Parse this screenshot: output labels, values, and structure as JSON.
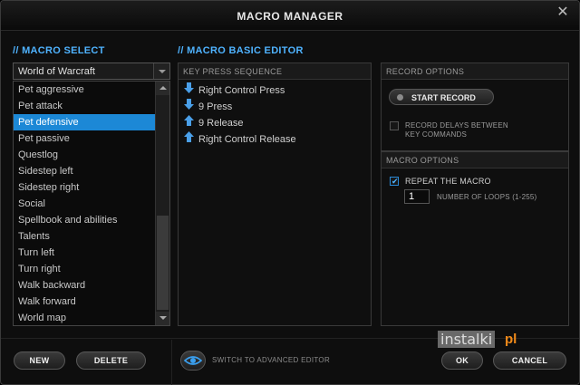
{
  "window": {
    "title": "MACRO MANAGER",
    "close_glyph": "✕"
  },
  "macro_select": {
    "section_title": "// MACRO SELECT",
    "game": "World of Warcraft",
    "items": [
      {
        "label": "Pet aggressive",
        "selected": false
      },
      {
        "label": "Pet attack",
        "selected": false
      },
      {
        "label": "Pet defensive",
        "selected": true
      },
      {
        "label": "Pet passive",
        "selected": false
      },
      {
        "label": "Questlog",
        "selected": false
      },
      {
        "label": "Sidestep left",
        "selected": false
      },
      {
        "label": "Sidestep right",
        "selected": false
      },
      {
        "label": "Social",
        "selected": false
      },
      {
        "label": "Spellbook and abilities",
        "selected": false
      },
      {
        "label": "Talents",
        "selected": false
      },
      {
        "label": "Turn left",
        "selected": false
      },
      {
        "label": "Turn right",
        "selected": false
      },
      {
        "label": "Walk backward",
        "selected": false
      },
      {
        "label": "Walk forward",
        "selected": false
      },
      {
        "label": "World map",
        "selected": false
      }
    ]
  },
  "editor": {
    "section_title": "// MACRO BASIC EDITOR",
    "sequence_header": "KEY PRESS SEQUENCE",
    "sequence": [
      {
        "direction": "down",
        "label": "Right Control Press"
      },
      {
        "direction": "down",
        "label": "9 Press"
      },
      {
        "direction": "up",
        "label": "9 Release"
      },
      {
        "direction": "up",
        "label": "Right Control Release"
      }
    ]
  },
  "record_options": {
    "header": "RECORD OPTIONS",
    "start_record": "START RECORD",
    "record_delays_line1": "RECORD DELAYS BETWEEN",
    "record_delays_line2": "KEY COMMANDS",
    "record_delays_checked": false
  },
  "macro_options": {
    "header": "MACRO OPTIONS",
    "repeat_label": "REPEAT THE MACRO",
    "repeat_checked": true,
    "loops_value": "1",
    "loops_label": "NUMBER OF LOOPS (1-255)"
  },
  "footer": {
    "new": "NEW",
    "delete": "DELETE",
    "switch_advanced": "SWITCH TO ADVANCED EDITOR",
    "ok": "OK",
    "cancel": "CANCEL"
  },
  "watermark": {
    "text": "instalki",
    "suffix": "pl"
  },
  "colors": {
    "accent": "#4fb3ff",
    "selected_bg": "#1c88d6",
    "arrow": "#4a9fe8"
  }
}
